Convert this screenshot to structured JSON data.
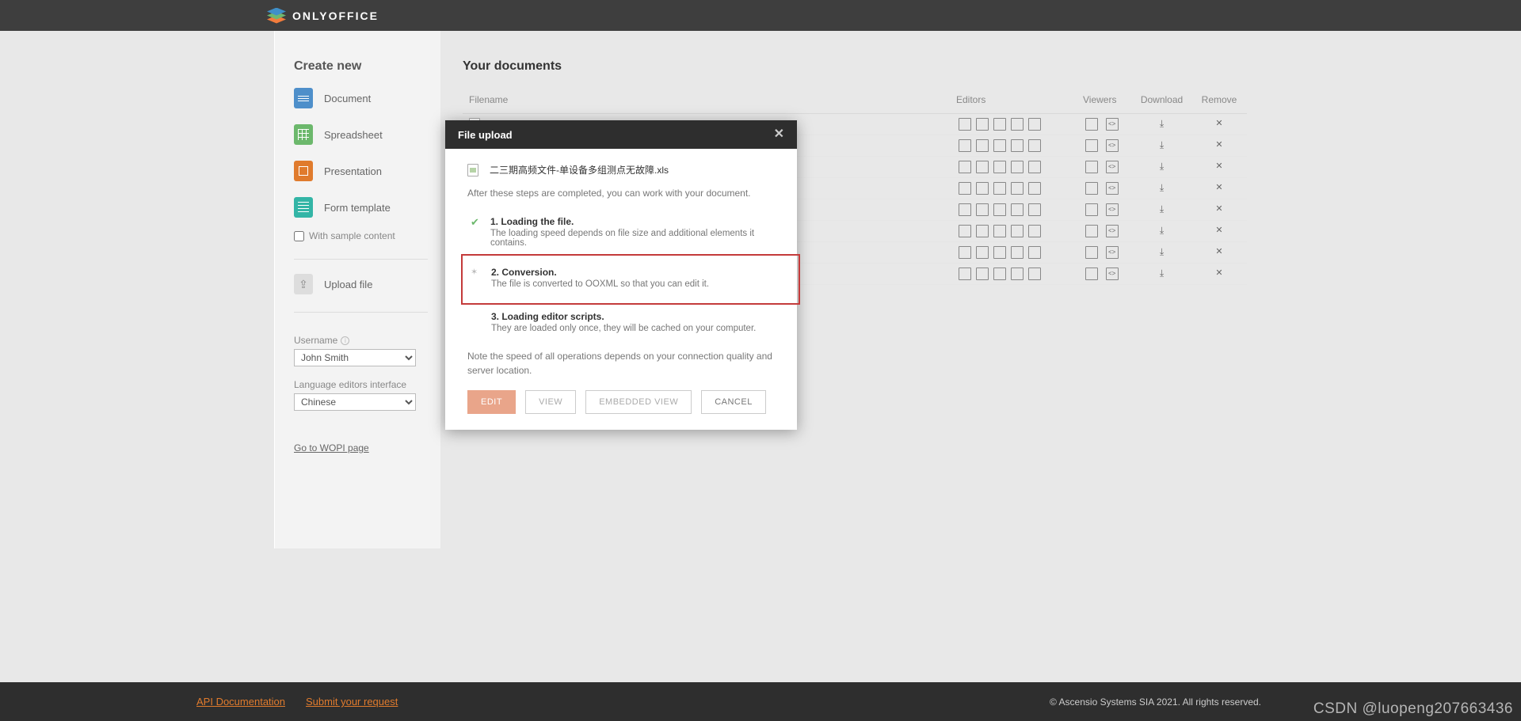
{
  "header": {
    "brand": "ONLYOFFICE"
  },
  "sidebar": {
    "create_heading": "Create new",
    "items": [
      {
        "label": "Document"
      },
      {
        "label": "Spreadsheet"
      },
      {
        "label": "Presentation"
      },
      {
        "label": "Form template"
      }
    ],
    "sample_label": "With sample content",
    "upload_label": "Upload file",
    "username_label": "Username",
    "username_value": "John Smith",
    "lang_label": "Language editors interface",
    "lang_value": "Chinese",
    "wopi_link": "Go to WOPI page"
  },
  "content": {
    "title": "Your documents",
    "columns": {
      "filename": "Filename",
      "editors": "Editors",
      "viewers": "Viewers",
      "download": "Download",
      "remove": "Remove"
    },
    "row_count": 8
  },
  "modal": {
    "title": "File upload",
    "file_name": "二三期高频文件-单设备多组测点无故障.xls",
    "intro": "After these steps are completed, you can work with your document.",
    "steps": [
      {
        "status": "done",
        "title": "1. Loading the file.",
        "desc": "The loading speed depends on file size and additional elements it contains."
      },
      {
        "status": "active",
        "title": "2. Conversion.",
        "desc": "The file is converted to OOXML so that you can edit it."
      },
      {
        "status": "pending",
        "title": "3. Loading editor scripts.",
        "desc": "They are loaded only once, they will be cached on your computer."
      }
    ],
    "note": "Note the speed of all operations depends on your connection quality and server location.",
    "buttons": {
      "edit": "Edit",
      "view": "View",
      "embedded": "Embedded view",
      "cancel": "Cancel"
    }
  },
  "footer": {
    "links": [
      {
        "label": "API Documentation"
      },
      {
        "label": "Submit your request"
      }
    ],
    "copyright": "© Ascensio Systems SIA 2021. All rights reserved."
  },
  "watermark": "CSDN @luopeng207663436"
}
